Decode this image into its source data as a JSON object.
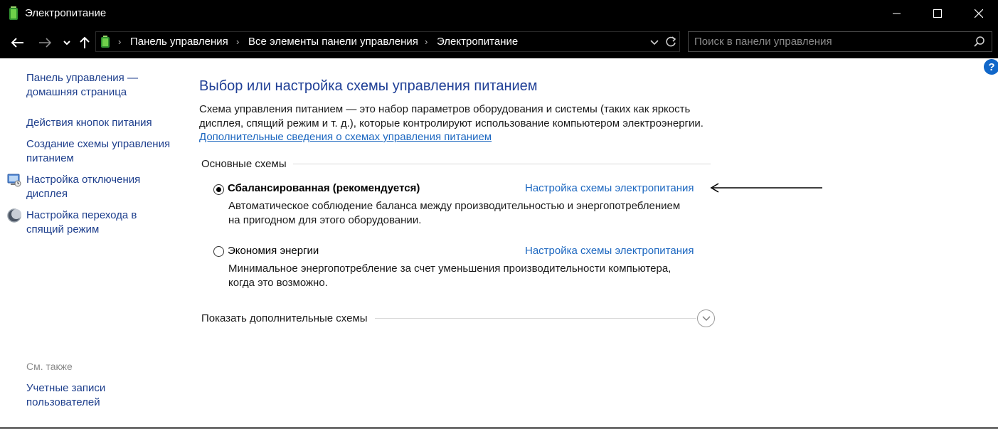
{
  "window": {
    "title": "Электропитание",
    "controls": {
      "minimize_icon": "minimize-icon",
      "maximize_icon": "maximize-icon",
      "close_icon": "close-icon"
    }
  },
  "navigation": {
    "breadcrumbs": [
      "Панель управления",
      "Все элементы панели управления",
      "Электропитание"
    ],
    "search": {
      "placeholder": "Поиск в панели управления",
      "value": ""
    }
  },
  "help": {
    "label": "?"
  },
  "sidebar": {
    "home_link": [
      "Панель управления —",
      "домашняя страница"
    ],
    "links": [
      {
        "lines": [
          "Действия кнопок питания"
        ],
        "icon": ""
      },
      {
        "lines": [
          "Создание схемы управления",
          "питанием"
        ],
        "icon": ""
      },
      {
        "lines": [
          "Настройка отключения",
          "дисплея"
        ],
        "icon": "display-icon"
      },
      {
        "lines": [
          "Настройка перехода в",
          "спящий режим"
        ],
        "icon": "moon-icon"
      }
    ],
    "see_also": {
      "heading": "См. также",
      "links": [
        {
          "lines": [
            "Учетные записи",
            "пользователей"
          ]
        }
      ]
    }
  },
  "main": {
    "title": "Выбор или настройка схемы управления питанием",
    "description": [
      "Схема управления питанием — это набор параметров оборудования и системы (таких как яркость",
      "дисплея, спящий режим и т. д.), которые контролируют использование компьютером электроэнергии."
    ],
    "info_link": "Дополнительные сведения о схемах управления питанием",
    "group_label": "Основные схемы",
    "plans": [
      {
        "name": "Сбалансированная (рекомендуется)",
        "selected": true,
        "configure_link": "Настройка схемы электропитания",
        "description": [
          "Автоматическое соблюдение баланса между производительностью и энергопотреблением",
          "на пригодном для этого оборудовании."
        ]
      },
      {
        "name": "Экономия энергии",
        "selected": false,
        "configure_link": "Настройка схемы электропитания",
        "description": [
          "Минимальное энергопотребление за счет уменьшения производительности компьютера,",
          "когда это возможно."
        ]
      }
    ],
    "show_more": "Показать дополнительные схемы"
  },
  "colors": {
    "chrome": "#000000",
    "link": "#1c67c0",
    "title": "#1f3f96",
    "help": "#1167c9"
  }
}
